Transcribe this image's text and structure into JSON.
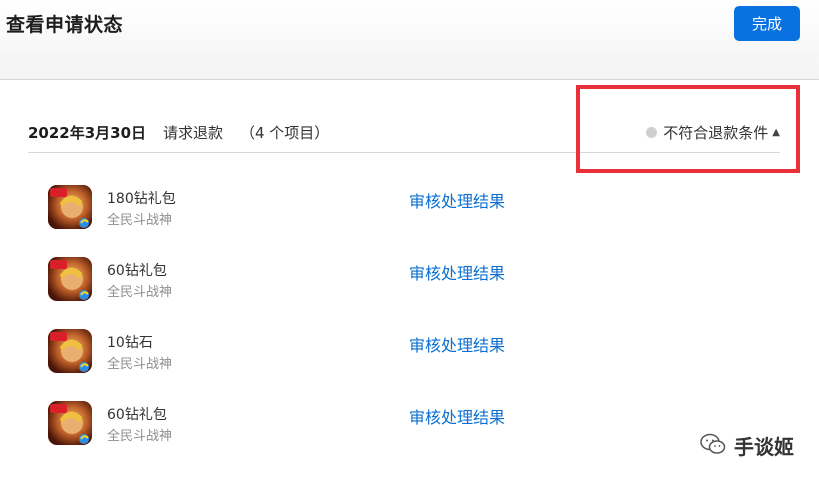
{
  "header": {
    "title": "查看申请状态",
    "done_label": "完成"
  },
  "request": {
    "date": "2022年3月30日",
    "type": "请求退款",
    "count": "（4 个项目）",
    "status": "不符合退款条件",
    "status_chevron": "^"
  },
  "items": [
    {
      "name": "180钻礼包",
      "app": "全民斗战神",
      "link": "审核处理结果"
    },
    {
      "name": "60钻礼包",
      "app": "全民斗战神",
      "link": "审核处理结果"
    },
    {
      "name": "10钻石",
      "app": "全民斗战神",
      "link": "审核处理结果"
    },
    {
      "name": "60钻礼包",
      "app": "全民斗战神",
      "link": "审核处理结果"
    }
  ],
  "watermark": {
    "text": "手谈姬"
  },
  "colors": {
    "accent": "#0a71e0",
    "link": "#0a6fd1",
    "highlight": "#e8313a",
    "status_dot": "#cfcfcf"
  }
}
